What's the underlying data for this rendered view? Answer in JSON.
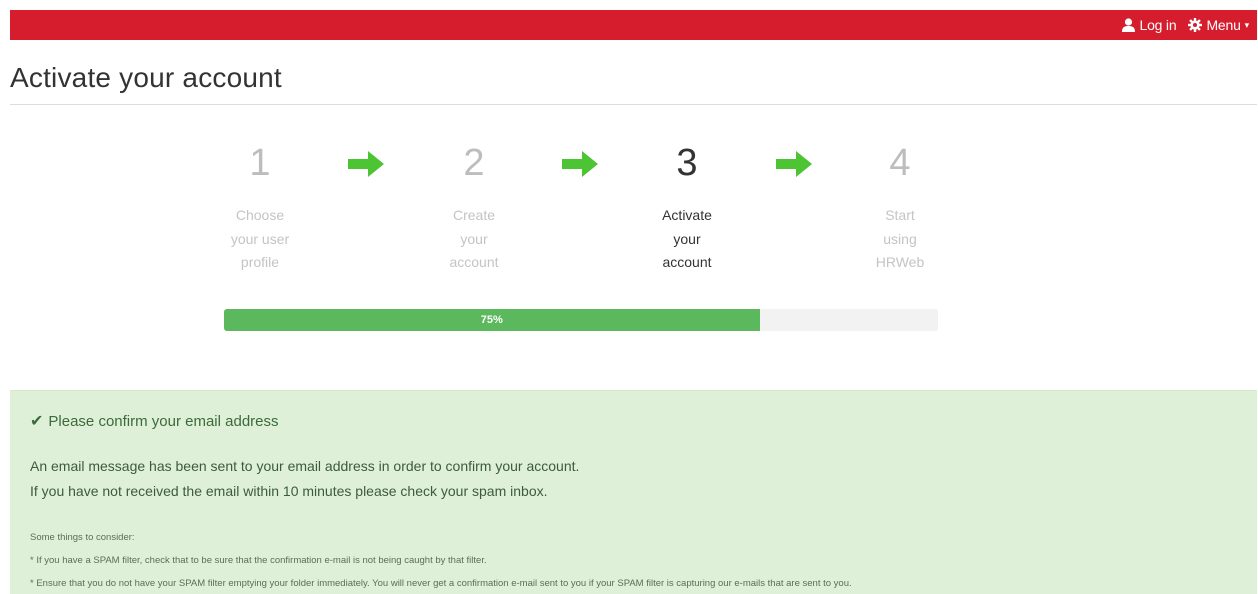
{
  "nav": {
    "login_label": "Log in",
    "menu_label": "Menu",
    "user_icon": "user-icon",
    "gear_icon": "gear-icon",
    "caret_icon": "caret-down-icon"
  },
  "page": {
    "title": "Activate your account"
  },
  "steps": [
    {
      "number": "1",
      "line1": "Choose",
      "line2": "your user",
      "line3": "profile"
    },
    {
      "number": "2",
      "line1": "Create",
      "line2": "your",
      "line3": "account"
    },
    {
      "number": "3",
      "line1": "Activate",
      "line2": "your",
      "line3": "account"
    },
    {
      "number": "4",
      "line1": "Start",
      "line2": "using",
      "line3": "HRWeb"
    }
  ],
  "active_step": 3,
  "progress": {
    "value": 0.75,
    "label": "75%"
  },
  "alert": {
    "heading": "Please confirm your email address",
    "message_line1": "An email message has been sent to your email address in order to confirm your account.",
    "message_line2": "If you have not received the email within 10 minutes please check your spam inbox.",
    "consider_title": "Some things to consider:",
    "tip1": "* If you have a SPAM filter, check that to be sure that the confirmation e-mail is not being caught by that filter.",
    "tip2": "* Ensure that you do not have your SPAM filter emptying your folder immediately. You will never get a confirmation e-mail sent to you if your SPAM filter is capturing our e-mails that are sent to you."
  },
  "colors": {
    "brand_red": "#d51d2e",
    "progress_green": "#5cb85c",
    "arrow_green": "#4cc433",
    "alert_bg": "#dff0d8"
  }
}
